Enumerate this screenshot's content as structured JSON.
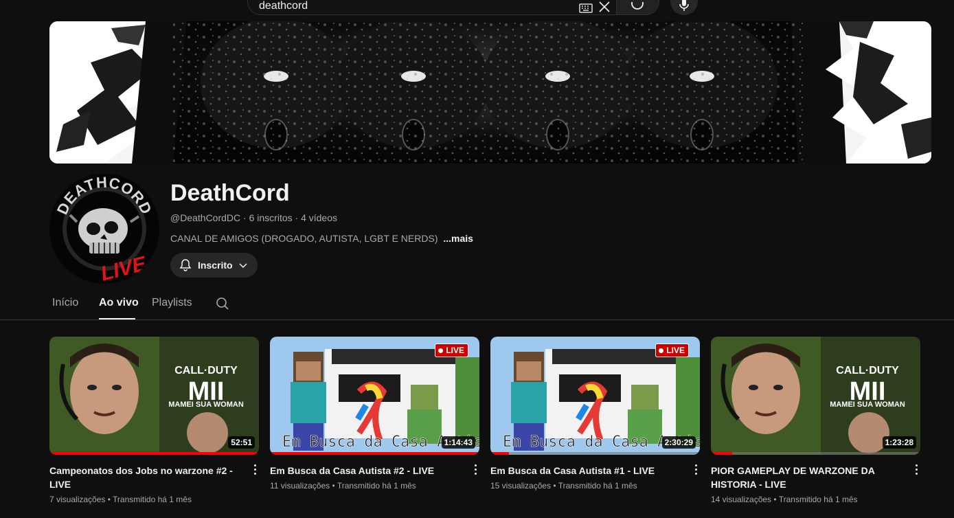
{
  "search": {
    "value": "deathcord"
  },
  "channel": {
    "name": "DeathCord",
    "handle": "@DeathCordDC",
    "subscribers": "6 inscritos",
    "videos_count": "4 vídeos",
    "description": "CANAL DE AMIGOS (DROGADO, AUTISTA, LGBT E NERDS)",
    "more_label": "...mais",
    "subscribe_label": "Inscrito",
    "avatar_top_text": "DEATHCORD",
    "avatar_bottom_text": "LIVE"
  },
  "tabs": [
    {
      "label": "Início",
      "active": false
    },
    {
      "label": "Ao vivo",
      "active": true
    },
    {
      "label": "Playlists",
      "active": false
    }
  ],
  "videos": [
    {
      "title": "Campeonatos dos Jobs no warzone #2 - LIVE",
      "duration": "52:51",
      "views": "7 visualizações",
      "streamed": "Transmitido há 1 mês",
      "progress": 1.0,
      "live_badge": false,
      "thumb_text_1": "CALL·DUTY",
      "thumb_text_2": "MII",
      "thumb_text_3": "MAMEI SUA WOMAN"
    },
    {
      "title": "Em Busca da Casa Autista #2 - LIVE",
      "duration": "1:14:43",
      "views": "11 visualizações",
      "streamed": "Transmitido há 1 mês",
      "progress": 1.0,
      "live_badge": true,
      "thumb_text_1": "Em Busca da Casa Autista"
    },
    {
      "title": "Em Busca da Casa Autista #1 - LIVE",
      "duration": "2:30:29",
      "views": "15 visualizações",
      "streamed": "Transmitido há 1 mês",
      "progress": 0.09,
      "live_badge": true,
      "thumb_text_1": "Em Busca da Casa Autista"
    },
    {
      "title": "PIOR GAMEPLAY DE WARZONE DA HISTORIA - LIVE",
      "duration": "1:23:28",
      "views": "14 visualizações",
      "streamed": "Transmitido há 1 mês",
      "progress": 0.1,
      "live_badge": false,
      "thumb_text_1": "CALL·DUTY",
      "thumb_text_2": "MII",
      "thumb_text_3": "MAMEI SUA WOMAN"
    }
  ],
  "live_label": "LIVE",
  "colors": {
    "background": "#0f0f0f",
    "progress": "#ff0000",
    "live": "#cc0000",
    "chip": "#272727"
  }
}
